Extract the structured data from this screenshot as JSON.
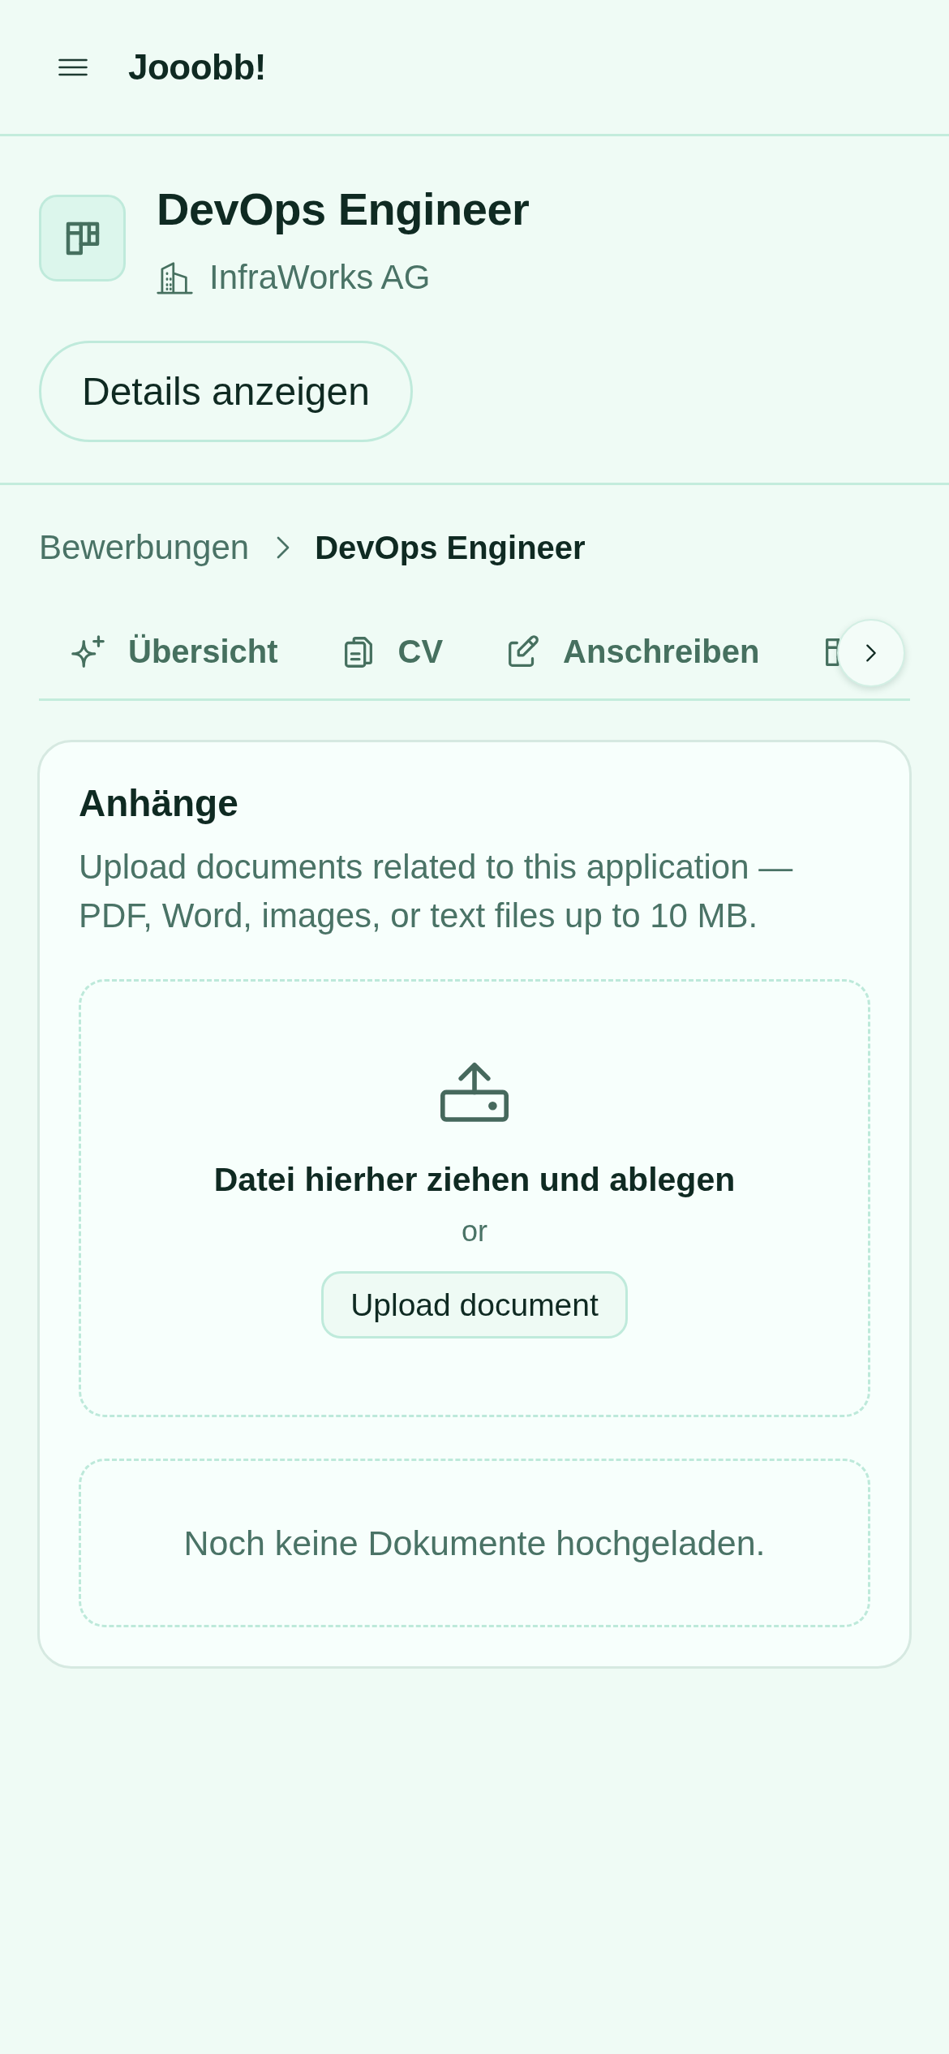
{
  "header": {
    "logo": "Jooobb!"
  },
  "job": {
    "title": "DevOps Engineer",
    "company": "InfraWorks AG",
    "details_button": "Details anzeigen"
  },
  "breadcrumb": [
    {
      "label": "Bewerbungen",
      "current": false
    },
    {
      "label": "DevOps Engineer",
      "current": true
    }
  ],
  "tabs": [
    {
      "kind": "overview",
      "label": "Übersicht",
      "selected": false
    },
    {
      "kind": "cv",
      "label": "CV",
      "selected": false
    },
    {
      "kind": "cover_letter",
      "label": "Anschreiben",
      "selected": false
    },
    {
      "kind": "board",
      "selected": false
    }
  ],
  "attachments": {
    "title": "Anhänge",
    "description": "Upload documents related to this application — PDF, Word, images, or text files up to 10 MB.",
    "dropzone": {
      "prompt": "Datei hierher ziehen und ablegen",
      "separator": "or",
      "button": "Upload document"
    },
    "empty_message": "Noch keine Dokumente hochgeladen."
  }
}
